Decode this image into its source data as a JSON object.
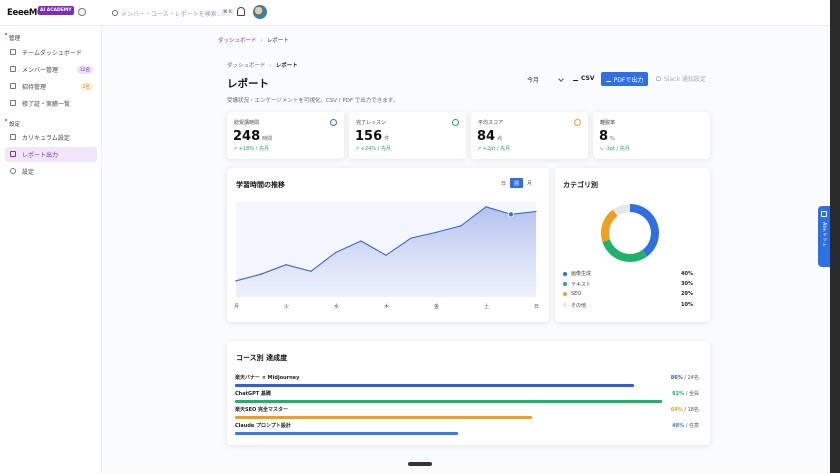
{
  "brand": {
    "name": "EeeeMO",
    "badge": "AI ACADEMY"
  },
  "search": {
    "placeholder": "メンバー・コース・レポートを検索…",
    "kbd": "⌘ K"
  },
  "sidebar": {
    "sections": [
      {
        "title": "管理",
        "items": [
          {
            "label": "チームダッシュボード",
            "icon": "dashboard-icon"
          },
          {
            "label": "メンバー管理",
            "icon": "users-icon",
            "badge": "12名"
          },
          {
            "label": "招待管理",
            "icon": "invite-icon",
            "badge": "2名"
          },
          {
            "label": "修了証・実績一覧",
            "icon": "certificate-icon"
          }
        ]
      },
      {
        "title": "設定",
        "items": [
          {
            "label": "カリキュラム設定",
            "icon": "curriculum-icon"
          },
          {
            "label": "レポート出力",
            "icon": "report-icon",
            "active": true
          },
          {
            "label": "設定",
            "icon": "gear-icon"
          }
        ]
      }
    ]
  },
  "breadcrumb_top": {
    "home": "ダッシュボード",
    "sep": "›",
    "current": "レポート"
  },
  "breadcrumb": {
    "home": "ダッシュボード",
    "sep": "›",
    "current": "レポート"
  },
  "page": {
    "title": "レポート",
    "subtitle": "受講状況・エンゲージメントを可視化。CSV / PDF で出力できます。"
  },
  "actions": {
    "period": "今月",
    "csv": "CSV",
    "pdf": "PDFで出力",
    "slack": "Slack 通知設定"
  },
  "kpis": [
    {
      "label": "総受講時間",
      "value": "248",
      "unit": "時間",
      "delta": "+18% / 先月",
      "trend": "up",
      "color": "#2f6fe4"
    },
    {
      "label": "完了レッスン",
      "value": "156",
      "unit": "件",
      "delta": "+24% / 先月",
      "trend": "up",
      "color": "#1fb26b"
    },
    {
      "label": "平均スコア",
      "value": "84",
      "unit": "点",
      "delta": "+2pt / 先月",
      "trend": "up",
      "color": "#f0a020"
    },
    {
      "label": "離脱率",
      "value": "8",
      "unit": "%",
      "delta": "-3pt / 先月",
      "trend": "down",
      "color": "#2f6fe4"
    }
  ],
  "trend_chart": {
    "title": "学習時間の推移",
    "tabs": [
      "日",
      "週",
      "月"
    ],
    "active_tab": "週"
  },
  "category_chart": {
    "title": "カテゴリ別"
  },
  "courses": {
    "title": "コース別 達成度",
    "rows": [
      {
        "name": "楽天バナー × Midjourney",
        "pct": 86,
        "pct_label": "86%",
        "count": "/ 24名",
        "color": "#2f5fd9"
      },
      {
        "name": "ChatGPT 基礎",
        "pct": 92,
        "pct_label": "92%",
        "count": "/ 全員",
        "color": "#1fb26b"
      },
      {
        "name": "楽天SEO 完全マスター",
        "pct": 64,
        "pct_label": "64%",
        "count": "/ 18名",
        "color": "#f0a020"
      },
      {
        "name": "Claude プロンプト設計",
        "pct": 48,
        "pct_label": "48%",
        "count": "/ 任意",
        "color": "#3b7be8"
      }
    ]
  },
  "ai_tab": {
    "label": "AIチャット"
  },
  "chart_data": [
    {
      "type": "area",
      "title": "学習時間の推移",
      "categories": [
        "月",
        "火",
        "水",
        "木",
        "金",
        "土",
        "日"
      ],
      "x": [
        0,
        1,
        2,
        3,
        4,
        5,
        6,
        7,
        8,
        9,
        10,
        11,
        12
      ],
      "values": [
        17,
        24,
        34,
        27,
        47,
        59,
        44,
        62,
        68,
        75,
        95,
        87,
        90
      ],
      "ylim": [
        0,
        100
      ],
      "grid": false,
      "highlight_index": 11,
      "color": "#3a64c8"
    },
    {
      "type": "pie",
      "title": "カテゴリ別",
      "categories": [
        "画像生成",
        "テキスト",
        "SEO",
        "その他"
      ],
      "values": [
        40,
        30,
        20,
        10
      ],
      "labels": [
        "40%",
        "30%",
        "20%",
        "10%"
      ],
      "colors": [
        "#2f6fe4",
        "#1fb26b",
        "#f0a020",
        "#e4e7ec"
      ],
      "legend": "bottom"
    }
  ]
}
